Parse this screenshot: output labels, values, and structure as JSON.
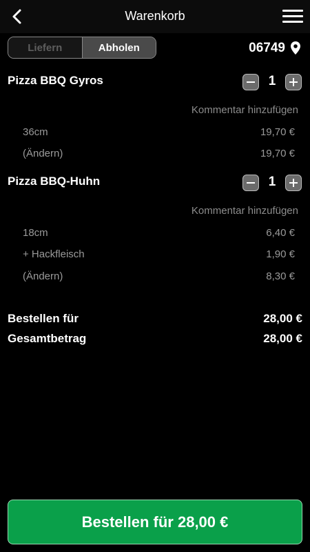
{
  "header": {
    "title": "Warenkorb",
    "back_icon": "chevron-left-icon",
    "menu_icon": "hamburger-menu-icon"
  },
  "delivery_toggle": {
    "options": [
      "Liefern",
      "Abholen"
    ],
    "selected": "Abholen"
  },
  "location": {
    "zip": "06749",
    "icon": "location-pin-icon"
  },
  "cart_items": [
    {
      "name": "Pizza BBQ Gyros",
      "quantity": "1",
      "comment_label": "Kommentar hinzufügen",
      "options": [
        {
          "label": "36cm",
          "price": "19,70 €"
        },
        {
          "label": "(Ändern)",
          "price": "19,70 €"
        }
      ]
    },
    {
      "name": "Pizza BBQ-Huhn",
      "quantity": "1",
      "comment_label": "Kommentar hinzufügen",
      "options": [
        {
          "label": "18cm",
          "price": "6,40 €"
        },
        {
          "label": "+ Hackfleisch",
          "price": "1,90 €"
        },
        {
          "label": "(Ändern)",
          "price": "8,30 €"
        }
      ]
    }
  ],
  "summary": {
    "order_for_label": "Bestellen für",
    "order_for_value": "28,00 €",
    "total_label": "Gesamtbetrag",
    "total_value": "28,00 €"
  },
  "order_button": {
    "label": "Bestellen für 28,00 €"
  },
  "colors": {
    "background": "#000000",
    "accent_green": "#0aa04a",
    "muted_text": "#9a9a9a"
  }
}
